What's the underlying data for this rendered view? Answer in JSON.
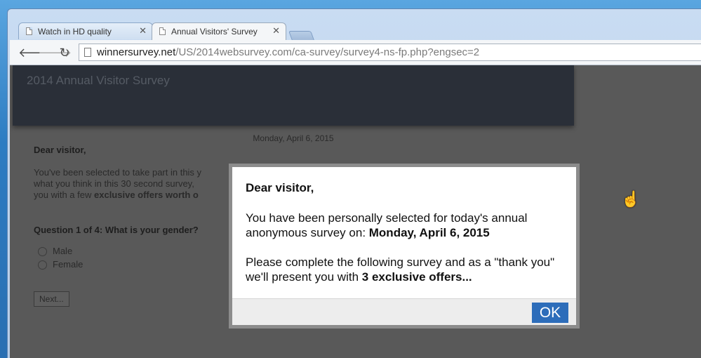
{
  "browser": {
    "tabs": [
      {
        "title": "Watch in HD quality",
        "active": false
      },
      {
        "title": "Annual Visitors' Survey",
        "active": true
      }
    ],
    "url_host": "winnersurvey.net",
    "url_path": "/US/2014websurvey.com/ca-survey/survey4-ns-fp.php?engsec=2"
  },
  "page": {
    "header_title": "2014 Annual Visitor Survey",
    "date": "Monday, April 6, 2015",
    "greeting": "Dear visitor,",
    "intro_line1": "You've been selected to take part in this y",
    "intro_line2": "what you think in this 30 second survey,",
    "intro_line3_pre": "you with a few ",
    "intro_line3_bold": "exclusive offers worth o",
    "question": "Question 1 of 4: What is your gender?",
    "options": [
      "Male",
      "Female"
    ],
    "next_label": "Next..."
  },
  "modal": {
    "greeting": "Dear visitor,",
    "p1_text": "You have been personally selected for today's annual anonymous survey on: ",
    "p1_bold": "Monday, April 6, 2015",
    "p2_text": "Please complete the following survey and as a \"thank you\" we'll present you with ",
    "p2_bold": "3 exclusive offers...",
    "ok_label": "OK"
  }
}
